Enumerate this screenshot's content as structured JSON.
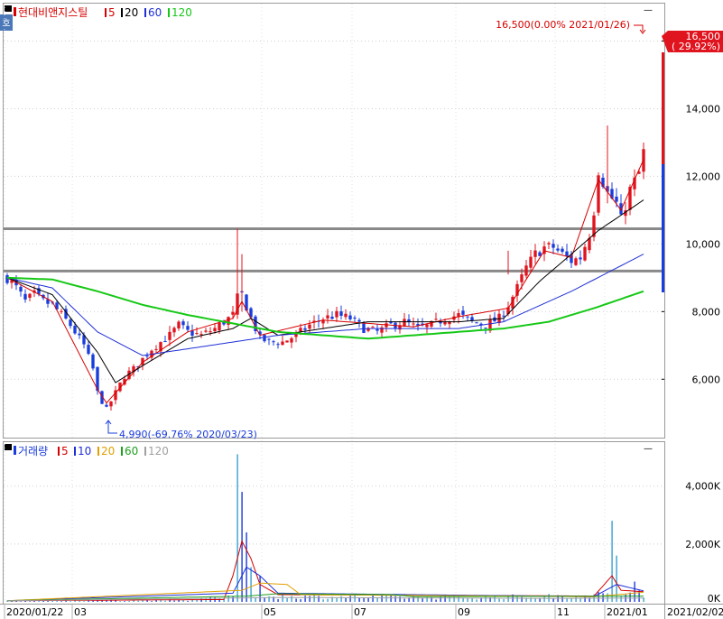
{
  "window": {
    "side_tab_label": "호",
    "close_glyph": "—"
  },
  "price_panel": {
    "legend": {
      "title": "현대비앤지스틸",
      "ma": [
        {
          "label": "5",
          "color": "#d60000"
        },
        {
          "label": "20",
          "color": "#000000"
        },
        {
          "label": "60",
          "color": "#1f2fd6"
        },
        {
          "label": "120",
          "color": "#16c816"
        }
      ]
    },
    "y_ticks": [
      "6,000",
      "8,000",
      "10,000",
      "12,000",
      "14,000",
      "16,000"
    ],
    "top_annotation": "16,500(0.00% 2021/01/26)",
    "current_price": {
      "price": "16,500",
      "change": "( 29.92%)"
    },
    "low_annotation": "4,990(-69.76% 2020/03/23)"
  },
  "volume_panel": {
    "legend": {
      "title": "거래량",
      "ma": [
        {
          "label": "5",
          "color": "#d60000"
        },
        {
          "label": "10",
          "color": "#1f2fd6"
        },
        {
          "label": "20",
          "color": "#e0a000"
        },
        {
          "label": "60",
          "color": "#20a020"
        },
        {
          "label": "120",
          "color": "#a0a0a0"
        }
      ]
    },
    "y_ticks": [
      "0K",
      "2,000K",
      "4,000K"
    ]
  },
  "x_axis": {
    "labels": [
      "2020/01/22",
      "03",
      "05",
      "07",
      "09",
      "11",
      "2021/01"
    ],
    "end_label": "2021/02/02"
  },
  "colors": {
    "up": "#e0141e",
    "down": "#1a3cdc",
    "ma5": "#d60000",
    "ma20": "#000000",
    "ma60": "#1f2fd6",
    "ma120": "#16c816",
    "hline": "#8a8a8a"
  },
  "chart_data": [
    {
      "type": "candlestick",
      "title": "현대비앤지스틸",
      "x_start": "2020/01/22",
      "x_end": "2021/02/02",
      "ylim": [
        4300,
        17000
      ],
      "y_ticks": [
        6000,
        8000,
        10000,
        12000,
        14000,
        16000
      ],
      "horizontal_lines": [
        10450,
        9200
      ],
      "close_path": [
        [
          0,
          9000
        ],
        [
          2,
          8700
        ],
        [
          4,
          8300
        ],
        [
          6,
          8500
        ],
        [
          8,
          8300
        ],
        [
          10,
          8200
        ],
        [
          12,
          7900
        ],
        [
          14,
          7600
        ],
        [
          15,
          7400
        ],
        [
          17,
          7000
        ],
        [
          19,
          6300
        ],
        [
          20,
          5600
        ],
        [
          22,
          5100
        ],
        [
          24,
          5600
        ],
        [
          26,
          6100
        ],
        [
          28,
          6300
        ],
        [
          30,
          6600
        ],
        [
          32,
          6900
        ],
        [
          34,
          7100
        ],
        [
          36,
          7300
        ],
        [
          38,
          7600
        ],
        [
          40,
          7400
        ],
        [
          43,
          7300
        ],
        [
          46,
          7500
        ],
        [
          48,
          7700
        ],
        [
          50,
          7900
        ],
        [
          51,
          8400
        ],
        [
          52,
          8500
        ],
        [
          54,
          7800
        ],
        [
          56,
          7200
        ],
        [
          58,
          7100
        ],
        [
          61,
          7100
        ],
        [
          64,
          7300
        ],
        [
          67,
          7600
        ],
        [
          70,
          7800
        ],
        [
          73,
          7900
        ],
        [
          76,
          7800
        ],
        [
          79,
          7500
        ],
        [
          82,
          7400
        ],
        [
          85,
          7600
        ],
        [
          88,
          7700
        ],
        [
          91,
          7500
        ],
        [
          94,
          7600
        ],
        [
          97,
          7800
        ],
        [
          100,
          7900
        ],
        [
          103,
          7700
        ],
        [
          106,
          7600
        ],
        [
          109,
          7800
        ],
        [
          111,
          8200
        ],
        [
          113,
          8700
        ],
        [
          115,
          9300
        ],
        [
          117,
          9700
        ],
        [
          119,
          9900
        ],
        [
          121,
          9900
        ],
        [
          123,
          9700
        ],
        [
          125,
          9500
        ],
        [
          127,
          9600
        ],
        [
          129,
          10300
        ],
        [
          130,
          11000
        ],
        [
          131,
          12200
        ],
        [
          133,
          11500
        ],
        [
          135,
          11200
        ],
        [
          136,
          10700
        ],
        [
          138,
          11600
        ],
        [
          140,
          12100
        ],
        [
          141,
          12700
        ]
      ],
      "ma_values": {
        "5": [
          [
            0,
            9000
          ],
          [
            10,
            8300
          ],
          [
            20,
            5700
          ],
          [
            22,
            5300
          ],
          [
            30,
            6500
          ],
          [
            40,
            7400
          ],
          [
            50,
            7800
          ],
          [
            52,
            8300
          ],
          [
            56,
            7300
          ],
          [
            70,
            7750
          ],
          [
            90,
            7550
          ],
          [
            100,
            7850
          ],
          [
            111,
            8100
          ],
          [
            119,
            9800
          ],
          [
            125,
            9600
          ],
          [
            131,
            11900
          ],
          [
            136,
            11000
          ],
          [
            141,
            12500
          ]
        ],
        "20": [
          [
            0,
            9000
          ],
          [
            10,
            8500
          ],
          [
            20,
            6800
          ],
          [
            24,
            5900
          ],
          [
            30,
            6400
          ],
          [
            40,
            7200
          ],
          [
            50,
            7500
          ],
          [
            54,
            7800
          ],
          [
            60,
            7300
          ],
          [
            80,
            7700
          ],
          [
            100,
            7700
          ],
          [
            110,
            7800
          ],
          [
            118,
            8900
          ],
          [
            125,
            9700
          ],
          [
            131,
            10400
          ],
          [
            141,
            11300
          ]
        ],
        "60": [
          [
            0,
            9000
          ],
          [
            10,
            8700
          ],
          [
            20,
            7400
          ],
          [
            30,
            6700
          ],
          [
            40,
            6900
          ],
          [
            50,
            7100
          ],
          [
            60,
            7300
          ],
          [
            80,
            7500
          ],
          [
            100,
            7500
          ],
          [
            110,
            7700
          ],
          [
            125,
            8600
          ],
          [
            141,
            9700
          ]
        ],
        "120": [
          [
            0,
            9000
          ],
          [
            10,
            8950
          ],
          [
            20,
            8600
          ],
          [
            30,
            8200
          ],
          [
            40,
            7900
          ],
          [
            50,
            7650
          ],
          [
            60,
            7400
          ],
          [
            80,
            7200
          ],
          [
            100,
            7400
          ],
          [
            110,
            7500
          ],
          [
            120,
            7700
          ],
          [
            130,
            8100
          ],
          [
            141,
            8600
          ]
        ]
      }
    },
    {
      "type": "bar",
      "title": "거래량",
      "ylim": [
        0,
        5300
      ],
      "y_ticks": [
        0,
        2000,
        4000
      ],
      "y_unit": "K",
      "spikes": [
        [
          51,
          5100
        ],
        [
          52,
          3800
        ],
        [
          53,
          2400
        ],
        [
          54,
          1200
        ],
        [
          56,
          900
        ],
        [
          134,
          2800
        ],
        [
          135,
          1600
        ],
        [
          139,
          700
        ]
      ],
      "baseline_volume": [
        [
          0,
          40
        ],
        [
          40,
          60
        ],
        [
          50,
          200
        ],
        [
          60,
          180
        ],
        [
          100,
          150
        ],
        [
          125,
          200
        ],
        [
          141,
          300
        ]
      ],
      "ma_values": {
        "5": [
          [
            0,
            40
          ],
          [
            48,
            80
          ],
          [
            50,
            900
          ],
          [
            52,
            2100
          ],
          [
            54,
            1500
          ],
          [
            56,
            600
          ],
          [
            60,
            250
          ],
          [
            130,
            200
          ],
          [
            134,
            900
          ],
          [
            136,
            400
          ],
          [
            141,
            350
          ]
        ],
        "10": [
          [
            0,
            40
          ],
          [
            50,
            300
          ],
          [
            53,
            1200
          ],
          [
            56,
            900
          ],
          [
            60,
            300
          ],
          [
            130,
            180
          ],
          [
            135,
            600
          ],
          [
            141,
            380
          ]
        ],
        "20": [
          [
            0,
            40
          ],
          [
            52,
            400
          ],
          [
            56,
            650
          ],
          [
            62,
            600
          ],
          [
            65,
            250
          ],
          [
            130,
            180
          ],
          [
            141,
            330
          ]
        ],
        "60": [
          [
            0,
            40
          ],
          [
            53,
            200
          ],
          [
            60,
            280
          ],
          [
            85,
            250
          ],
          [
            90,
            180
          ],
          [
            141,
            200
          ]
        ],
        "120": [
          [
            0,
            40
          ],
          [
            60,
            150
          ],
          [
            120,
            120
          ],
          [
            141,
            130
          ]
        ]
      }
    }
  ]
}
